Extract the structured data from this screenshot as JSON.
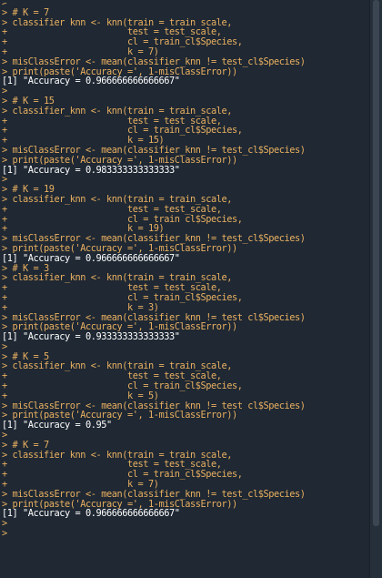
{
  "console": {
    "lines": [
      {
        "t": "> ",
        "k": "cmd"
      },
      {
        "t": "> # K = 7",
        "k": "cmd"
      },
      {
        "t": "> classifier_knn <- knn(train = train_scale,",
        "k": "cmd"
      },
      {
        "t": "+                       test = test_scale,",
        "k": "cmd"
      },
      {
        "t": "+                       cl = train_cl$Species,",
        "k": "cmd"
      },
      {
        "t": "+                       k = 7)",
        "k": "cmd"
      },
      {
        "t": "> misClassError <- mean(classifier_knn != test_cl$Species)",
        "k": "cmd"
      },
      {
        "t": "> print(paste('Accuracy =', 1-misClassError))",
        "k": "cmd"
      },
      {
        "t": "[1] \"Accuracy = 0.966666666666667\"",
        "k": "out"
      },
      {
        "t": "> ",
        "k": "cmd"
      },
      {
        "t": "> # K = 15",
        "k": "cmd"
      },
      {
        "t": "> classifier_knn <- knn(train = train_scale,",
        "k": "cmd"
      },
      {
        "t": "+                       test = test_scale,",
        "k": "cmd"
      },
      {
        "t": "+                       cl = train_cl$Species,",
        "k": "cmd"
      },
      {
        "t": "+                       k = 15)",
        "k": "cmd"
      },
      {
        "t": "> misClassError <- mean(classifier_knn != test_cl$Species)",
        "k": "cmd"
      },
      {
        "t": "> print(paste('Accuracy =', 1-misClassError))",
        "k": "cmd"
      },
      {
        "t": "[1] \"Accuracy = 0.983333333333333\"",
        "k": "out"
      },
      {
        "t": "> ",
        "k": "cmd"
      },
      {
        "t": "> # K = 19",
        "k": "cmd"
      },
      {
        "t": "> classifier_knn <- knn(train = train_scale,",
        "k": "cmd"
      },
      {
        "t": "+                       test = test_scale,",
        "k": "cmd"
      },
      {
        "t": "+                       cl = train_cl$Species,",
        "k": "cmd"
      },
      {
        "t": "+                       k = 19)",
        "k": "cmd"
      },
      {
        "t": "> misClassError <- mean(classifier_knn != test_cl$Species)",
        "k": "cmd"
      },
      {
        "t": "> print(paste('Accuracy =', 1-misClassError))",
        "k": "cmd"
      },
      {
        "t": "[1] \"Accuracy = 0.966666666666667\"",
        "k": "out"
      },
      {
        "t": "> # K = 3",
        "k": "cmd"
      },
      {
        "t": "> classifier_knn <- knn(train = train_scale,",
        "k": "cmd"
      },
      {
        "t": "+                       test = test_scale,",
        "k": "cmd"
      },
      {
        "t": "+                       cl = train_cl$Species,",
        "k": "cmd"
      },
      {
        "t": "+                       k = 3)",
        "k": "cmd"
      },
      {
        "t": "> misClassError <- mean(classifier_knn != test_cl$Species)",
        "k": "cmd"
      },
      {
        "t": "> print(paste('Accuracy =', 1-misClassError))",
        "k": "cmd"
      },
      {
        "t": "[1] \"Accuracy = 0.933333333333333\"",
        "k": "out"
      },
      {
        "t": "> ",
        "k": "cmd"
      },
      {
        "t": "> # K = 5",
        "k": "cmd"
      },
      {
        "t": "> classifier_knn <- knn(train = train_scale,",
        "k": "cmd"
      },
      {
        "t": "+                       test = test_scale,",
        "k": "cmd"
      },
      {
        "t": "+                       cl = train_cl$Species,",
        "k": "cmd"
      },
      {
        "t": "+                       k = 5)",
        "k": "cmd"
      },
      {
        "t": "> misClassError <- mean(classifier_knn != test_cl$Species)",
        "k": "cmd"
      },
      {
        "t": "> print(paste('Accuracy =', 1-misClassError))",
        "k": "cmd"
      },
      {
        "t": "[1] \"Accuracy = 0.95\"",
        "k": "out"
      },
      {
        "t": "> ",
        "k": "cmd"
      },
      {
        "t": "> # K = 7",
        "k": "cmd"
      },
      {
        "t": "> classifier_knn <- knn(train = train_scale,",
        "k": "cmd"
      },
      {
        "t": "+                       test = test_scale,",
        "k": "cmd"
      },
      {
        "t": "+                       cl = train_cl$Species,",
        "k": "cmd"
      },
      {
        "t": "+                       k = 7)",
        "k": "cmd"
      },
      {
        "t": "> misClassError <- mean(classifier_knn != test_cl$Species)",
        "k": "cmd"
      },
      {
        "t": "> print(paste('Accuracy =', 1-misClassError))",
        "k": "cmd"
      },
      {
        "t": "[1] \"Accuracy = 0.966666666666667\"",
        "k": "out"
      },
      {
        "t": "> ",
        "k": "cmd"
      },
      {
        "t": "> ",
        "k": "cmd"
      }
    ]
  },
  "colors": {
    "background": "#1f2833",
    "command_text": "#e9b061",
    "output_text": "#ffffff"
  }
}
